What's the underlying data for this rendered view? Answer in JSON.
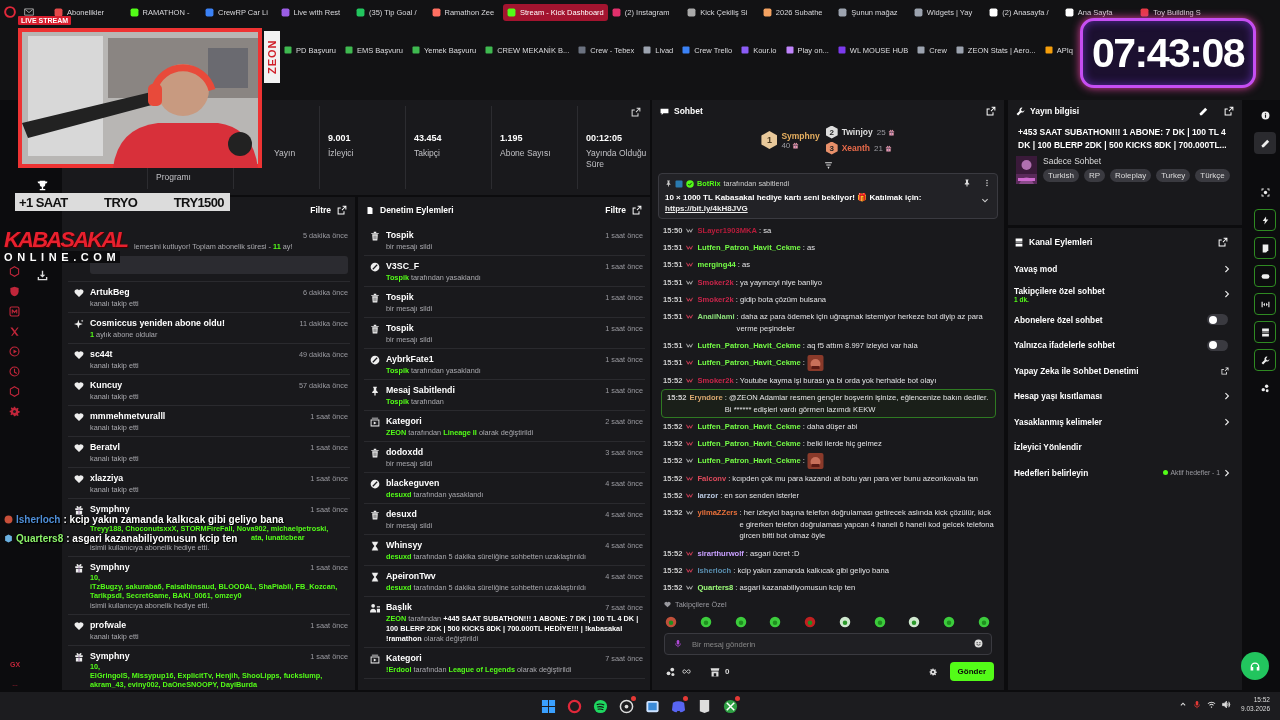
{
  "browser": {
    "tabs": [
      {
        "label": "Abonelikler",
        "selected": false
      },
      {
        "label": "RAMATHON -",
        "selected": false
      },
      {
        "label": "CrewRP Car Li",
        "selected": false
      },
      {
        "label": "Live with Rest",
        "selected": false
      },
      {
        "label": "(35) Tip Goal /",
        "selected": false
      },
      {
        "label": "Ramathon Zee",
        "selected": false
      },
      {
        "label": "Stream - Kick Dashboard",
        "selected": true
      },
      {
        "label": "(2) Instagram",
        "selected": false
      },
      {
        "label": "Kick Çekiliş Si",
        "selected": false
      },
      {
        "label": "2026 Subathe",
        "selected": false
      },
      {
        "label": "Şunun mağaz",
        "selected": false
      },
      {
        "label": "Widgets | Yay",
        "selected": false
      },
      {
        "label": "(2) Anasayfa /",
        "selected": false
      },
      {
        "label": "Ana Sayfa",
        "selected": false
      },
      {
        "label": "Toy Building S",
        "selected": false
      }
    ],
    "bookmarks": [
      "PD Başvuru",
      "EMS Başvuru",
      "Yemek Başvuru",
      "CREW MEKANİK B...",
      "Crew - Tebex",
      "Livad",
      "Crew Trello",
      "Kour.io",
      "Play on...",
      "WL MOUSE HUB",
      "Crew",
      "ZEON Stats | Aero...",
      "APIq"
    ],
    "sidebar_label": "GX"
  },
  "stats": [
    {
      "label": "Programı"
    },
    {
      "label": "Yayın"
    },
    {
      "value": "9.001",
      "label": "İzleyici"
    },
    {
      "value": "43.454",
      "label": "Takipçi"
    },
    {
      "value": "1.195",
      "label": "Abone Sayısı"
    },
    {
      "value": "00:12:05",
      "label": "Yayında Olduğu Süre"
    }
  ],
  "activity": {
    "filter": "Filtre",
    "items": [
      {
        "kind": "resub",
        "time": "5 dakika önce",
        "detail": "lemesini kutluyor! Toplam abonelik süresi - **11** ay!"
      },
      {
        "kind": "follow",
        "name": "ArtukBeg",
        "detail": "kanalı takip etti",
        "time": "6 dakika önce"
      },
      {
        "kind": "sub",
        "name": "Cosmiccus yeniden abone oldu!",
        "detail": "**1** aylık abone oldular",
        "time": "11 dakika önce"
      },
      {
        "kind": "follow",
        "name": "sc44t",
        "detail": "kanalı takip etti",
        "time": "49 dakika önce"
      },
      {
        "kind": "follow",
        "name": "Kuncuy",
        "detail": "kanalı takip etti",
        "time": "57 dakika önce"
      },
      {
        "kind": "follow",
        "name": "mmmehmetvuralll",
        "detail": "kanalı takip etti",
        "time": "1 saat önce"
      },
      {
        "kind": "follow",
        "name": "Beratvl",
        "detail": "kanalı takip etti",
        "time": "1 saat önce"
      },
      {
        "kind": "follow",
        "name": "xlazziya",
        "detail": "kanalı takip etti",
        "time": "1 saat önce"
      },
      {
        "kind": "gift",
        "name": "Symphny",
        "time": "1 saat önce",
        "recipients": "Treyy188, ChoconutsxxX, STORMFireFall, Nova902, michaelpetroski,",
        "tail": "ata, lunaticbear",
        "detail": "isimli kullanıcıya abonelik hediye etti."
      },
      {
        "kind": "gift",
        "name": "Symphny",
        "time": "1 saat önce",
        "count": "10,",
        "recipients": "iTzBugzy, sakuraba6, Faisalbinsaud, BLOODAL, ShaPiabli, FB_Kozcan, Tarikpsdl, SecretGame, BAKI_0061, omzey0",
        "detail": "isimli kullanıcıya abonelik hediye etti."
      },
      {
        "kind": "follow",
        "name": "profwale",
        "detail": "kanalı takip etti",
        "time": "1 saat önce"
      },
      {
        "kind": "gift",
        "name": "Symphny",
        "time": "1 saat önce",
        "count": "10,",
        "recipients": "ElGringolS, Missypup16, ExplicitTv, Henjih, ShooLipps, fuckslump, akram_43, eviny002, DaOneSNOOPY, DayiBurda"
      }
    ]
  },
  "moderation": {
    "title": "Denetim Eylemleri",
    "filter": "Filtre",
    "items": [
      {
        "kind": "delete",
        "name": "Tospik",
        "detail": "bir mesajı sildi",
        "time": "1 saat önce"
      },
      {
        "kind": "ban",
        "name": "V3SC_F",
        "detail": "**Tospik** tarafından yasaklandı",
        "time": "1 saat önce"
      },
      {
        "kind": "delete",
        "name": "Tospik",
        "detail": "bir mesajı sildi",
        "time": "1 saat önce"
      },
      {
        "kind": "delete",
        "name": "Tospik",
        "detail": "bir mesajı sildi",
        "time": "1 saat önce"
      },
      {
        "kind": "ban",
        "name": "AybrkFate1",
        "detail": "**Tospik** tarafından yasaklandı",
        "time": "1 saat önce"
      },
      {
        "kind": "pin",
        "name": "Mesaj Sabitlendi",
        "detail": "**Tospik** tarafından",
        "time": "1 saat önce"
      },
      {
        "kind": "category",
        "name": "Kategori",
        "detail": "**ZEON** tarafından **Lineage II** olarak değiştirildi",
        "time": "2 saat önce"
      },
      {
        "kind": "delete",
        "name": "dodoxdd",
        "detail": "bir mesajı sildi",
        "time": "3 saat önce"
      },
      {
        "kind": "ban",
        "name": "blackeguven",
        "detail": "**desuxd** tarafından yasaklandı",
        "time": "4 saat önce"
      },
      {
        "kind": "delete",
        "name": "desuxd",
        "detail": "bir mesajı sildi",
        "time": "4 saat önce"
      },
      {
        "kind": "timeout",
        "name": "Whinsyy",
        "detail": "**desuxd** tarafından 5 dakika süreliğine sohbetten uzaklaştırıldı",
        "time": "4 saat önce"
      },
      {
        "kind": "timeout",
        "name": "ApeironTwv",
        "detail": "**desuxd** tarafından 5 dakika süreliğine sohbetten uzaklaştırıldı",
        "time": "4 saat önce"
      },
      {
        "kind": "title",
        "name": "Başlık",
        "detail": "**ZEON** tarafından *+445 SAAT SUBATHON!!! 1 ABONE: 7 DK | 100 TL 4 DK | 100 BLERP 2DK | 500 KICKS 8DK | 700.000TL HEDİYE!!! | !kabasakal !ramathon* olarak değiştirildi",
        "time": "7 saat önce"
      },
      {
        "kind": "category",
        "name": "Kategori",
        "detail": "**!Erdool** tarafından **League of Legends** olarak değiştirildi",
        "time": "7 saat önce"
      }
    ]
  },
  "chat": {
    "title": "Sohbet",
    "leaders": [
      {
        "rank": "1",
        "name": "Symphny",
        "count": "40"
      },
      {
        "rank": "2",
        "name": "Twinjoy",
        "count": "25"
      },
      {
        "rank": "3",
        "name": "Xeanth",
        "count": "21"
      }
    ],
    "pinned": {
      "by": "BotRix",
      "note": "tarafından sabitlendi",
      "text": "10 × 1000 TL Kabasakal hediye kartı seni bekliyor! 🎁 Katılmak için:",
      "link": "https://bit.ly/4kH8JVG"
    },
    "messages": [
      {
        "time": "15:50",
        "user": "SLayer1903MKA",
        "color": "#b81c3b",
        "text": ": sa",
        "kind": "text",
        "highlighted": false
      },
      {
        "time": "15:51",
        "user": "Lutfen_Patron_Havit_Cekme",
        "color": "#75fd46",
        "text": ": as",
        "kind": "text",
        "highlighted": false
      },
      {
        "time": "15:51",
        "user": "merging44",
        "color": "#75fd46",
        "text": ": as",
        "kind": "text",
        "highlighted": false
      },
      {
        "time": "15:51",
        "user": "Smoker2k",
        "color": "#c8254a",
        "text": ": ya yayıncıyi niye banliyo",
        "kind": "text",
        "highlighted": false
      },
      {
        "time": "15:51",
        "user": "Smoker2k",
        "color": "#c8254a",
        "text": ": gidip bota çözüm bulsana",
        "kind": "text",
        "highlighted": false
      },
      {
        "time": "15:51",
        "user": "AnaiiNami",
        "color": "#8be07a",
        "text": ": daha az para ödemek için uğraşmak istemiyor herkeze bot diyip az para verme peşindeler",
        "kind": "text",
        "highlighted": false
      },
      {
        "time": "15:51",
        "user": "Lutfen_Patron_Havit_Cekme",
        "color": "#75fd46",
        "text": ": aq f5 attım 8.997 izleyici var hala",
        "kind": "text",
        "highlighted": false
      },
      {
        "time": "15:51",
        "user": "Lutfen_Patron_Havit_Cekme",
        "color": "#75fd46",
        "text": ":",
        "kind": "emote",
        "highlighted": false
      },
      {
        "time": "15:52",
        "user": "Smoker2k",
        "color": "#c8254a",
        "text": ": Youtube kayma işi burası ya bi orda yok herhalde bot olayı",
        "kind": "text",
        "highlighted": false
      },
      {
        "time": "15:52",
        "user": "Eryndore",
        "color": "#d8a870",
        "text": ": @ZEON Adamlar resmen gençler boşverin işinize, eğlencenize bakın dediler. Bi ****** edişleri vardı görmen lazımdı KEKW",
        "kind": "text",
        "highlighted": true
      },
      {
        "time": "15:52",
        "user": "Lutfen_Patron_Havit_Cekme",
        "color": "#75fd46",
        "text": ": daha düşer abi",
        "kind": "text",
        "highlighted": false
      },
      {
        "time": "15:52",
        "user": "Lutfen_Patron_Havit_Cekme",
        "color": "#75fd46",
        "text": ": belki ilerde hiç gelmez",
        "kind": "text",
        "highlighted": false
      },
      {
        "time": "15:52",
        "user": "Lutfen_Patron_Havit_Cekme",
        "color": "#75fd46",
        "text": ":",
        "kind": "emote",
        "highlighted": false
      },
      {
        "time": "15:52",
        "user": "Falconv",
        "color": "#e04a5c",
        "text": ": kcıpden çok mu para kazandı at botu yarı para ver bunu azeonkovala tan",
        "kind": "text",
        "highlighted": false
      },
      {
        "time": "15:52",
        "user": "Iarzor",
        "color": "#b8c8e0",
        "text": ": en son senden isterler",
        "kind": "text",
        "highlighted": false
      },
      {
        "time": "15:52",
        "user": "yilmaZZers",
        "color": "#e8703a",
        "text": ": her izleyici başına telefon doğrulaması getirecek aslında kick çözülür, kick e girerken telefon doğrulaması yapcan 4 haneli 6 haneli kod gelcek telefona gircen bitti bot olmaz öyle",
        "kind": "text",
        "highlighted": false
      },
      {
        "time": "15:52",
        "user": "sirarthurwolf",
        "color": "#c9a0ff",
        "text": ": asgari ücret :D",
        "kind": "text",
        "highlighted": false
      },
      {
        "time": "15:52",
        "user": "Isherloch",
        "color": "#5a8fb0",
        "text": ": kcip yakın zamanda kalkıcak gibi geliyo bana",
        "kind": "text",
        "highlighted": false
      },
      {
        "time": "15:52",
        "user": "Quarters8",
        "color": "#9dff7a",
        "text": ": asgari kazanabiliyomusun kcip ten",
        "kind": "text",
        "highlighted": false
      }
    ],
    "emote_label": "Takipçilere Özel",
    "placeholder": "Bir mesaj gönderin",
    "points": "0",
    "send": "Gönder"
  },
  "stream_info": {
    "title": "Yayın bilgisi",
    "stream_title": "+453 SAAT SUBATHON!!! 1 ABONE: 7 DK | 100 TL 4 DK | 100 BLERP 2DK | 500 KICKS 8DK | 700.000TL...",
    "category": "Sadece Sohbet",
    "tags": [
      "Turkish",
      "RP",
      "Roleplay",
      "Turkey",
      "Türkçe"
    ]
  },
  "channel_actions": {
    "title": "Kanal Eylemleri",
    "rows": [
      {
        "kind": "chevron",
        "label": "Yavaş mod"
      },
      {
        "kind": "chevron",
        "label": "Takipçilere özel sohbet",
        "sub": "1 dk."
      },
      {
        "kind": "toggle",
        "label": "Abonelere özel sohbet",
        "on": false
      },
      {
        "kind": "toggle",
        "label": "Yalnızca ifadelerle sohbet",
        "on": false
      },
      {
        "kind": "external",
        "label": "Yapay Zeka ile Sohbet Denetimi"
      },
      {
        "kind": "chevron",
        "label": "Hesap yaşı kısıtlaması"
      },
      {
        "kind": "chevron",
        "label": "Yasaklanmış kelimeler"
      },
      {
        "kind": "plain",
        "label": "İzleyici Yönlendir"
      },
      {
        "kind": "status",
        "label": "Hedefleri belirleyin",
        "status": "Aktif hedefler - 1"
      }
    ]
  },
  "rail": [
    {
      "kind": "plain",
      "selected": false
    },
    {
      "kind": "plain",
      "selected": true
    },
    {
      "kind": "plain",
      "selected": false
    },
    {
      "kind": "outlined",
      "selected": false
    },
    {
      "kind": "outlined",
      "selected": false
    },
    {
      "kind": "outlined",
      "selected": false
    },
    {
      "kind": "outlined",
      "selected": false
    },
    {
      "kind": "outlined",
      "selected": false
    },
    {
      "kind": "outlined",
      "selected": false
    },
    {
      "kind": "plain",
      "selected": false
    }
  ],
  "taskbar": {
    "time": "15:52",
    "date": "9.03.2026"
  },
  "overlay": {
    "live_badge": "LIVE STREAM",
    "cam_label": "ZEON",
    "clock": "07:43:08",
    "ticker": [
      "+1 SAAT",
      "TRYO",
      "TRY1500"
    ],
    "logo": {
      "main": "KABASAKAL",
      "sub": "ONLINE.COM"
    },
    "chat_lines": [
      {
        "user": "Isherloch",
        "color": "#4f8fd8",
        "text": ": kcip yakın zamanda kalkıcak gibi geliyo bana"
      },
      {
        "user": "Quarters8",
        "color": "#8cf36a",
        "text": ": asgari kazanabiliyomusun kcip ten"
      }
    ]
  }
}
